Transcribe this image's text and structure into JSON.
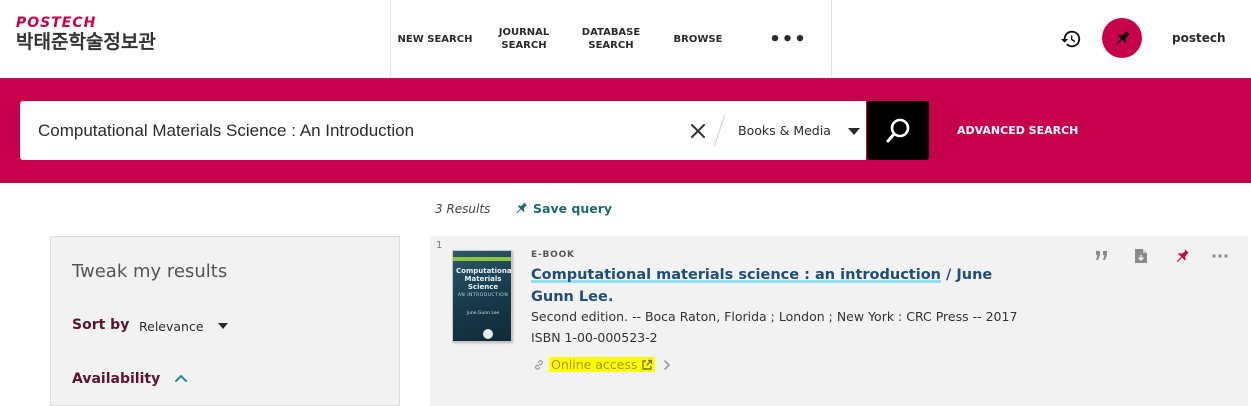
{
  "header": {
    "logo_top": "POSTECH",
    "logo_bottom": "박태준학술정보관",
    "nav": [
      {
        "label": "NEW SEARCH"
      },
      {
        "label": "JOURNAL\nSEARCH"
      },
      {
        "label": "DATABASE\nSEARCH"
      },
      {
        "label": "BROWSE"
      },
      {
        "label": "•••"
      }
    ],
    "user": "postech"
  },
  "search": {
    "query": "Computational Materials Science : An Introduction",
    "scope": "Books & Media",
    "advanced": "ADVANCED SEARCH"
  },
  "results_bar": {
    "count": "3 Results",
    "save_query": "Save query"
  },
  "sidebar": {
    "heading": "Tweak my results",
    "sort_label": "Sort by",
    "sort_value": "Relevance",
    "availability": "Availability"
  },
  "result": {
    "number": "1",
    "type": "E-BOOK",
    "title_link": "Computational materials science : an introduction",
    "title_rest": " / June Gunn Lee.",
    "details": "Second edition. -- Boca Raton, Florida ; London ; New York : CRC Press -- 2017",
    "isbn": "ISBN 1-00-000523-2",
    "online_access": "Online access",
    "cover": {
      "title": "Computational Materials Science",
      "subtitle": "AN INTRODUCTION",
      "author": "June Gunn Lee"
    }
  },
  "colors": {
    "brand": "#c7004c",
    "link": "#1f4e79",
    "save_query": "#1e6b6e",
    "highlight": "#ffff00"
  },
  "icons": [
    "history-icon",
    "pin-icon",
    "close-icon",
    "search-icon",
    "chevron-up-icon",
    "quote-icon",
    "document-icon",
    "more-icon",
    "link-icon",
    "external-link-icon",
    "chevron-right-icon"
  ]
}
